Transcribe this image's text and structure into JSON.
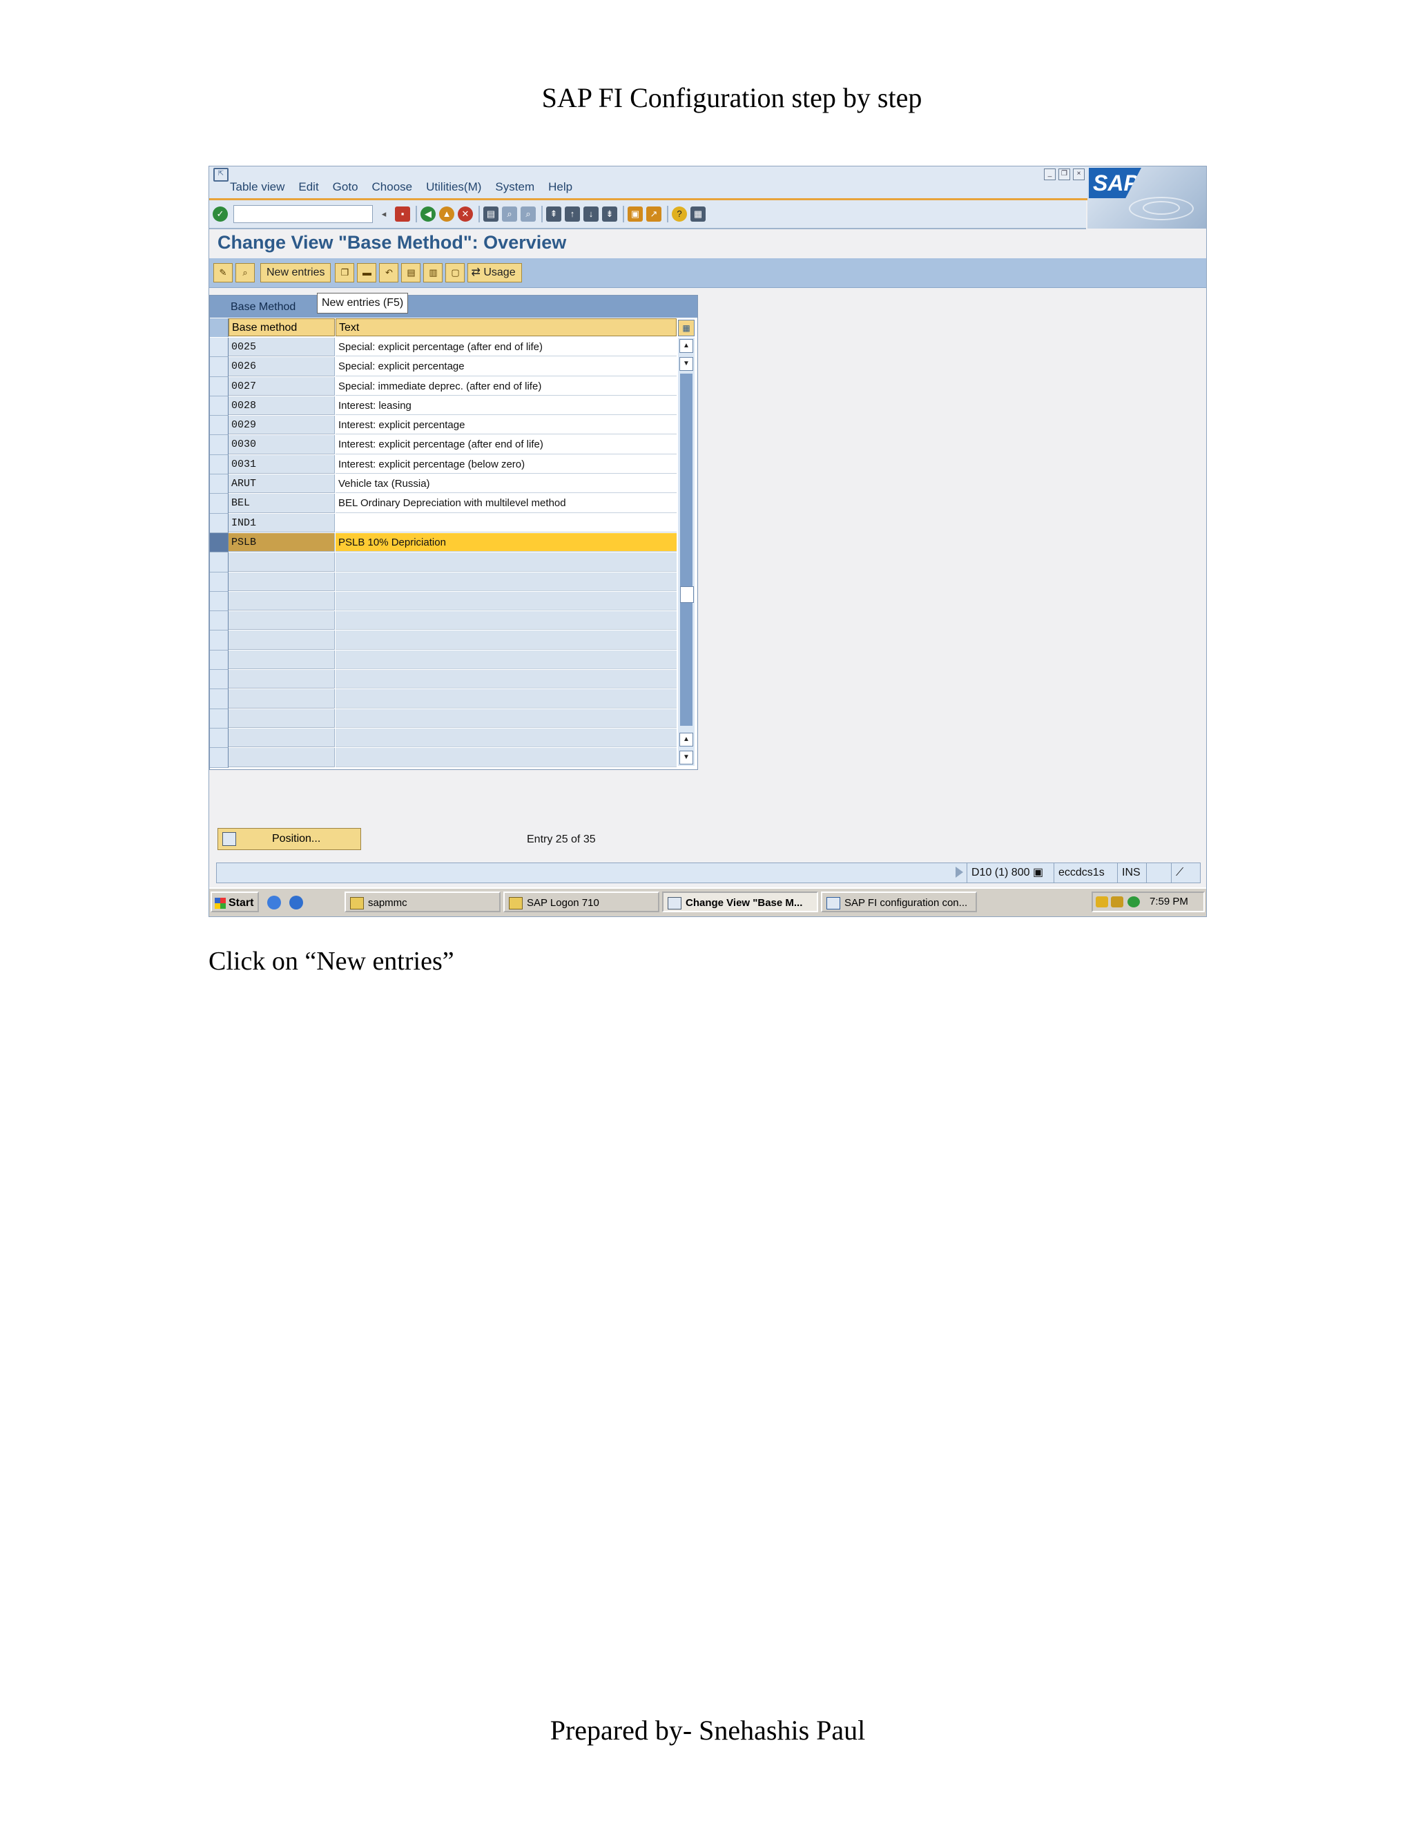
{
  "doc": {
    "header": "SAP FI Configuration step by step",
    "instruction": "Click on “New entries”",
    "footer": "Prepared by- Snehashis Paul"
  },
  "menu": [
    "Table view",
    "Edit",
    "Goto",
    "Choose",
    "Utilities(M)",
    "System",
    "Help"
  ],
  "logo_text": "SAP",
  "screen_title": "Change View \"Base Method\": Overview",
  "app_toolbar": {
    "new_entries": "New entries",
    "usage": "Usage"
  },
  "tooltip": "New entries   (F5)",
  "table": {
    "title": "Base Method",
    "columns": [
      "Base method",
      "Text"
    ],
    "rows": [
      {
        "code": "0025",
        "text": "Special: explicit percentage (after end of life)"
      },
      {
        "code": "0026",
        "text": "Special: explicit percentage"
      },
      {
        "code": "0027",
        "text": "Special: immediate deprec. (after end of life)"
      },
      {
        "code": "0028",
        "text": "Interest: leasing"
      },
      {
        "code": "0029",
        "text": "Interest: explicit percentage"
      },
      {
        "code": "0030",
        "text": "Interest: explicit percentage (after end of life)"
      },
      {
        "code": "0031",
        "text": "Interest: explicit percentage (below zero)"
      },
      {
        "code": "ARUT",
        "text": "Vehicle tax (Russia)"
      },
      {
        "code": "BEL",
        "text": "BEL Ordinary Depreciation with multilevel method"
      },
      {
        "code": "IND1",
        "text": ""
      },
      {
        "code": "PSLB",
        "text": "PSLB 10% Depriciation"
      }
    ],
    "selected_row": 10,
    "empty_rows": 11
  },
  "position_button": "Position...",
  "entry_info": "Entry 25 of 35",
  "status": {
    "system": "D10 (1) 800",
    "server": "eccdcs1s",
    "mode": "INS"
  },
  "taskbar": {
    "start": "Start",
    "tasks": [
      "sapmmc",
      "SAP Logon 710",
      "Change View \"Base M...",
      "SAP FI configuration con..."
    ],
    "clock": "7:59 PM"
  },
  "colors": {
    "highlight": "#ffcc33",
    "title_blue": "#2d5a8a",
    "toolbar_blue": "#a9c2e0"
  }
}
